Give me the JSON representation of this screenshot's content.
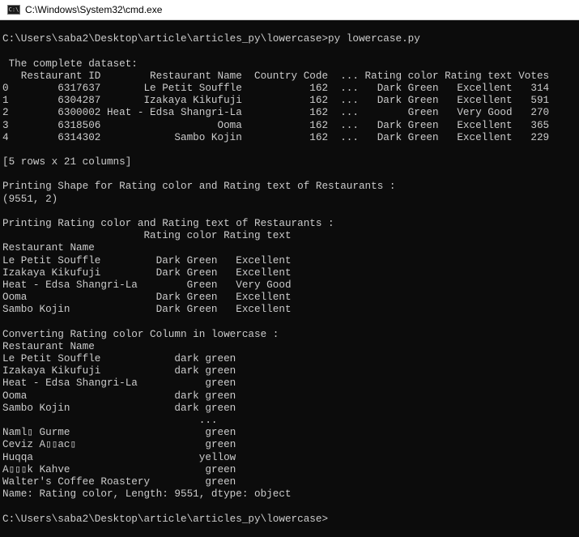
{
  "window": {
    "title": "C:\\Windows\\System32\\cmd.exe",
    "icon": "cmd-icon"
  },
  "colors": {
    "background": "#0c0c0c",
    "text": "#cccccc"
  },
  "lines": [
    "",
    "C:\\Users\\saba2\\Desktop\\article\\articles_py\\lowercase>py lowercase.py",
    "",
    " The complete dataset:",
    "   Restaurant ID        Restaurant Name  Country Code  ... Rating color Rating text Votes",
    "0        6317637       Le Petit Souffle           162  ...   Dark Green   Excellent   314",
    "1        6304287       Izakaya Kikufuji           162  ...   Dark Green   Excellent   591",
    "2        6300002 Heat - Edsa Shangri-La           162  ...        Green   Very Good   270",
    "3        6318506                   Ooma           162  ...   Dark Green   Excellent   365",
    "4        6314302            Sambo Kojin           162  ...   Dark Green   Excellent   229",
    "",
    "[5 rows x 21 columns]",
    "",
    "Printing Shape for Rating color and Rating text of Restaurants :",
    "(9551, 2)",
    "",
    "Printing Rating color and Rating text of Restaurants :",
    "                       Rating color Rating text",
    "Restaurant Name",
    "Le Petit Souffle         Dark Green   Excellent",
    "Izakaya Kikufuji         Dark Green   Excellent",
    "Heat - Edsa Shangri-La        Green   Very Good",
    "Ooma                     Dark Green   Excellent",
    "Sambo Kojin              Dark Green   Excellent",
    "",
    "Converting Rating color Column in lowercase :",
    "Restaurant Name",
    "Le Petit Souffle            dark green",
    "Izakaya Kikufuji            dark green",
    "Heat - Edsa Shangri-La           green",
    "Ooma                        dark green",
    "Sambo Kojin                 dark green",
    "                                ...",
    "Naml▯ Gurme                      green",
    "Ceviz A▯▯ac▯                     green",
    "Huqqa                           yellow",
    "A▯▯▯k Kahve                      green",
    "Walter's Coffee Roastery         green",
    "Name: Rating color, Length: 9551, dtype: object",
    "",
    "C:\\Users\\saba2\\Desktop\\article\\articles_py\\lowercase>"
  ]
}
